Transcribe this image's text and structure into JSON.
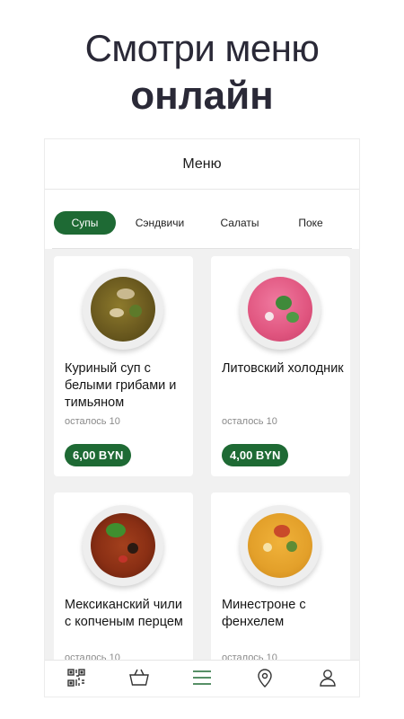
{
  "promo": {
    "line1": "Смотри меню",
    "line2": "онлайн"
  },
  "header": {
    "title": "Меню"
  },
  "tabs": [
    {
      "label": "Супы",
      "active": true
    },
    {
      "label": "Сэндвичи",
      "active": false
    },
    {
      "label": "Салаты",
      "active": false
    },
    {
      "label": "Поке",
      "active": false
    }
  ],
  "items": [
    {
      "name": "Куриный суп с белыми грибами и тимьяном",
      "stock": "осталось 10",
      "price": "6,00 BYN",
      "soup_color": "#6b5a1f",
      "garnish_color": "#5d7a2a"
    },
    {
      "name": "Литовский холодник",
      "stock": "осталось 10",
      "price": "4,00 BYN",
      "soup_color": "#e0557f",
      "garnish_color": "#3f8a3a"
    },
    {
      "name": "Мексиканский чили с копченым перцем",
      "stock": "осталось 10",
      "price": "",
      "soup_color": "#8a2f14",
      "garnish_color": "#3f8f2f"
    },
    {
      "name": "Минестроне с фенхелем",
      "stock": "осталось 10",
      "price": "",
      "soup_color": "#e3a02a",
      "garnish_color": "#c94a2a"
    }
  ],
  "colors": {
    "brand_green": "#1e6a34",
    "background_gray": "#f1f1f1"
  },
  "bottom_nav": [
    {
      "icon": "qr-code-icon",
      "active": false
    },
    {
      "icon": "shopping-basket-icon",
      "active": false
    },
    {
      "icon": "menu-list-icon",
      "active": true
    },
    {
      "icon": "location-pin-icon",
      "active": false
    },
    {
      "icon": "profile-icon",
      "active": false
    }
  ]
}
